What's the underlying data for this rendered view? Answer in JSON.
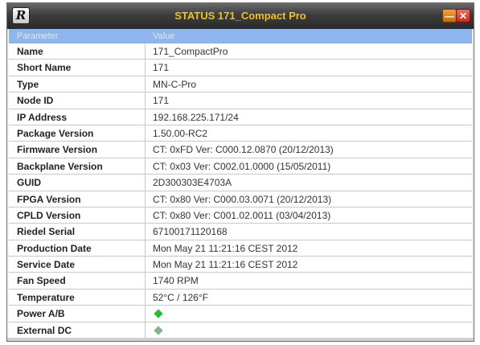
{
  "window": {
    "title": "STATUS 171_Compact Pro",
    "logo_letter": "R"
  },
  "table": {
    "columns": [
      "Parameter",
      "Value"
    ],
    "rows": [
      {
        "param": "Name",
        "value": "171_CompactPro"
      },
      {
        "param": "Short Name",
        "value": "171"
      },
      {
        "param": "Type",
        "value": "MN-C-Pro"
      },
      {
        "param": "Node ID",
        "value": "171"
      },
      {
        "param": "IP Address",
        "value": "192.168.225.171/24"
      },
      {
        "param": "Package Version",
        "value": "1.50.00-RC2"
      },
      {
        "param": "Firmware Version",
        "value": "CT: 0xFD Ver: C000.12.0870 (20/12/2013)"
      },
      {
        "param": "Backplane Version",
        "value": "CT: 0x03 Ver: C002.01.0000 (15/05/2011)"
      },
      {
        "param": "GUID",
        "value": "2D300303E4703A"
      },
      {
        "param": "FPGA Version",
        "value": "CT: 0x80 Ver: C000.03.0071 (20/12/2013)"
      },
      {
        "param": "CPLD Version",
        "value": "CT: 0x80 Ver: C001.02.0011 (03/04/2013)"
      },
      {
        "param": "Riedel Serial",
        "value": "67100171120168"
      },
      {
        "param": "Production Date",
        "value": "Mon May 21 11:21:16 CEST 2012"
      },
      {
        "param": "Service Date",
        "value": "Mon May 21 11:21:16 CEST 2012"
      },
      {
        "param": "Fan Speed",
        "value": "1740 RPM"
      },
      {
        "param": "Temperature",
        "value": "52°C / 126°F"
      },
      {
        "param": "Power A/B",
        "value": "",
        "indicator": "status-ok-icon",
        "indicator_color": "#22bb33"
      },
      {
        "param": "External DC",
        "value": "",
        "indicator": "status-off-icon",
        "indicator_color": "#88b088"
      }
    ]
  },
  "colors": {
    "title_text": "#f1c21e",
    "header_bg": "#8eb6ec",
    "ok": "#22bb33"
  }
}
